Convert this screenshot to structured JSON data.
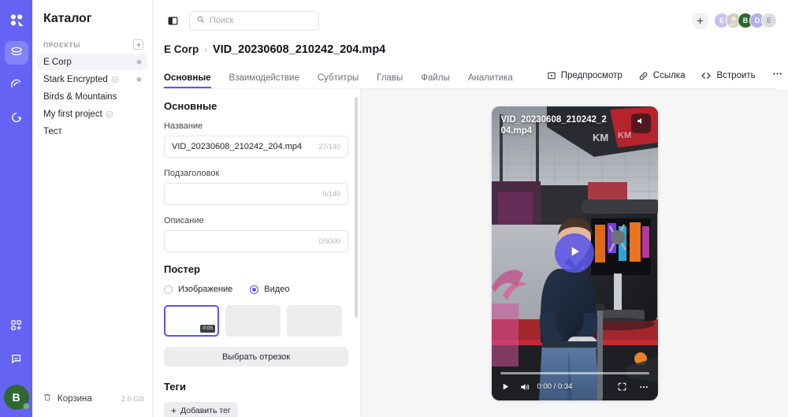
{
  "rail": {
    "logo_icon": "app-logo-icon",
    "items": [
      {
        "icon": "projects-folder-icon",
        "active": true
      },
      {
        "icon": "broadcast-icon",
        "active": false
      },
      {
        "icon": "analytics-pie-icon",
        "active": false
      }
    ],
    "bottom_items": [
      {
        "icon": "apps-grid-plus-icon"
      },
      {
        "icon": "chat-bubble-icon"
      }
    ],
    "avatar_initial": "B",
    "avatar_color": "#2e6930",
    "status_color": "#66c152"
  },
  "sidebar": {
    "title": "Каталог",
    "section_label": "ПРОЕКТЫ",
    "add_project_icon": "plus-box-icon",
    "projects": [
      {
        "name": "E Corp",
        "selected": true,
        "starred": true,
        "encrypted": false
      },
      {
        "name": "Stark Encrypted",
        "selected": false,
        "starred": true,
        "encrypted": true
      },
      {
        "name": "Birds & Mountains",
        "selected": false,
        "starred": false,
        "encrypted": false
      },
      {
        "name": "My first project",
        "selected": false,
        "starred": false,
        "encrypted": true
      },
      {
        "name": "Тест",
        "selected": false,
        "starred": false,
        "encrypted": false
      }
    ],
    "trash": {
      "label": "Корзина",
      "size": "2.6 GB",
      "icon": "trash-icon"
    }
  },
  "topbar": {
    "panel_toggle_icon": "side-panel-toggle-icon",
    "search": {
      "placeholder": "Поиск",
      "value": "",
      "icon": "search-icon"
    },
    "add_icon": "plus-icon",
    "avatars": [
      {
        "initial": "E",
        "color": "#c5c2f0"
      },
      {
        "initial": "",
        "color": "#e8e6f5"
      },
      {
        "initial": "B",
        "color": "#2e6930"
      },
      {
        "initial": "D",
        "color": "#b3aef0"
      },
      {
        "initial": "E",
        "color": "#dcdce2"
      }
    ]
  },
  "header": {
    "breadcrumb_project": "E Corp",
    "breadcrumb_separator": "›",
    "breadcrumb_file": "VID_20230608_210242_204.mp4",
    "tabs": [
      {
        "label": "Основные",
        "active": true
      },
      {
        "label": "Взаимодействие",
        "active": false
      },
      {
        "label": "Субтитры",
        "active": false
      },
      {
        "label": "Главы",
        "active": false
      },
      {
        "label": "Файлы",
        "active": false
      },
      {
        "label": "Аналитика",
        "active": false
      }
    ],
    "actions": [
      {
        "label": "Предпросмотр",
        "icon": "preview-play-box-icon"
      },
      {
        "label": "Ссылка",
        "icon": "link-icon"
      },
      {
        "label": "Встроить",
        "icon": "code-embed-icon"
      }
    ],
    "more_icon": "ellipsis-icon",
    "accent_color": "#5b57e8"
  },
  "form": {
    "section_title": "Основные",
    "fields": [
      {
        "label": "Название",
        "value": "VID_20230608_210242_204.mp4",
        "counter": "27/140"
      },
      {
        "label": "Подзаголовок",
        "value": "",
        "counter": "0/140"
      },
      {
        "label": "Описание",
        "value": "",
        "counter": "0/5000"
      }
    ],
    "poster": {
      "title": "Постер",
      "options": [
        {
          "label": "Изображение",
          "selected": false
        },
        {
          "label": "Видео",
          "selected": true
        }
      ],
      "thumbnails": [
        {
          "selected": true,
          "timestamp": "0:05"
        },
        {
          "selected": false,
          "timestamp": ""
        },
        {
          "selected": false,
          "timestamp": ""
        }
      ],
      "select_segment_label": "Выбрать отрезок"
    },
    "tags": {
      "title": "Теги",
      "add_label": "Добавить тег",
      "add_icon": "plus-icon"
    }
  },
  "player": {
    "video_title": "VID_20230608_210242_204.mp4",
    "mute_icon": "speaker-muted-icon",
    "play_icon": "play-icon",
    "current_time": "0:00",
    "duration": "0:34",
    "time_display": "0:00 / 0:34",
    "controls": {
      "play_icon": "play-icon",
      "volume_icon": "volume-icon",
      "fullscreen_icon": "fullscreen-icon",
      "more_icon": "ellipsis-icon"
    },
    "progress_percent": 0
  }
}
